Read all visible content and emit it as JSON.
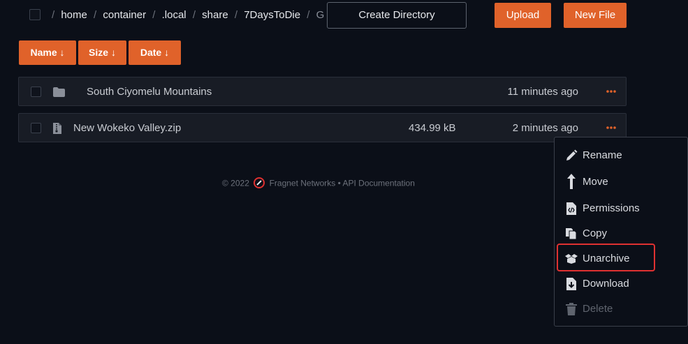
{
  "breadcrumb": {
    "segments": [
      "home",
      "container",
      ".local",
      "share",
      "7DaysToDie",
      "Generate"
    ]
  },
  "toolbar": {
    "create_directory_label": "Create Directory",
    "upload_label": "Upload",
    "new_file_label": "New File"
  },
  "sort": {
    "name_label": "Name ↓",
    "size_label": "Size ↓",
    "date_label": "Date ↓"
  },
  "files": [
    {
      "name": "South Ciyomelu Mountains",
      "size": "",
      "modified": "11 minutes ago",
      "icon": "folder-icon"
    },
    {
      "name": "New Wokeko Valley.zip",
      "size": "434.99 kB",
      "modified": "2 minutes ago",
      "icon": "archive-file-icon"
    }
  ],
  "footer": {
    "copyright": "© 2022",
    "company": "Fragnet Networks",
    "separator": "•",
    "api_link": "API Documentation"
  },
  "context_menu": {
    "items": [
      {
        "label": "Rename",
        "icon": "pencil-icon",
        "disabled": false
      },
      {
        "label": "Move",
        "icon": "arrow-up-icon",
        "disabled": false
      },
      {
        "label": "Permissions",
        "icon": "code-file-icon",
        "disabled": false
      },
      {
        "label": "Copy",
        "icon": "copy-icon",
        "disabled": false
      },
      {
        "label": "Unarchive",
        "icon": "box-open-icon",
        "disabled": false
      },
      {
        "label": "Download",
        "icon": "download-file-icon",
        "disabled": false
      },
      {
        "label": "Delete",
        "icon": "trash-icon",
        "disabled": true
      }
    ]
  },
  "colors": {
    "background": "#0b0f18",
    "accent": "#e0622a",
    "row_bg": "#181c25",
    "highlight": "#e03131"
  }
}
